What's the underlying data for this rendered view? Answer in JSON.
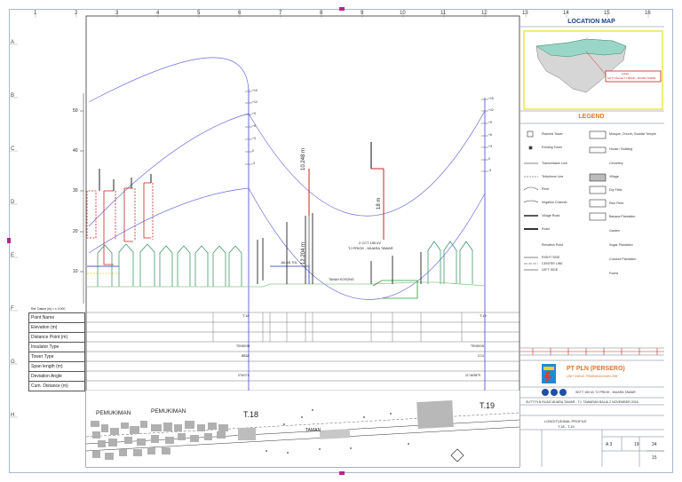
{
  "grid_columns": [
    "1",
    "2",
    "3",
    "4",
    "5",
    "6",
    "7",
    "8",
    "9",
    "10",
    "11",
    "12",
    "13",
    "14",
    "15",
    "16"
  ],
  "grid_rows": [
    "A",
    "B",
    "C",
    "D",
    "E",
    "F",
    "G",
    "H"
  ],
  "location_map": {
    "title": "LOCATION MAP",
    "callout_line1": "Lokasi",
    "callout_line2": "Sel TT Daerah TJ PRIOK - MUARA TAWAR"
  },
  "legend": {
    "title": "LEGEND",
    "left_items": [
      "Planned Tower",
      "Existing Tower",
      "Transmission Line",
      "Telephone Line",
      "River",
      "Irrigation Channel",
      "Village Road",
      "Road",
      "Elevation Point",
      "RIGHT SIDE",
      "CENTER LINE",
      "LEFT SIDE"
    ],
    "right_items": [
      "Mosque, Church, Buddist Temple",
      "House / Building",
      "Cemetery",
      "Village",
      "Dry Field",
      "Rice Field",
      "Banana Plantation",
      "Garden",
      "Sugar Plantation",
      "Coconut Plantation",
      "Forest"
    ]
  },
  "profile": {
    "y_ticks": [
      "50",
      "40",
      "30",
      "20",
      "10"
    ],
    "scale_note": "Ref. Datum (m) = ± 0.000",
    "clearance_vertical": "10.248 m",
    "clearance_lower": "12.204 m",
    "clearance_right": "18 m",
    "sag_label_1": "2 CCT 150 kV",
    "sag_label_2": "TJ PRIOK - MUARA TAWAR",
    "annotation_mid": "JALAN TOL",
    "annotation_right": "TANAH KOSONG",
    "tower_left_scale": [
      "+10",
      "+12",
      "+9",
      "+6",
      "+3",
      "0",
      "-3"
    ],
    "tower_right_scale": [
      "+15",
      "+12",
      "+9",
      "+6",
      "+3",
      "0",
      "-3"
    ]
  },
  "table": {
    "rows": [
      "Point Name",
      "Elevation (m)",
      "Distance  Point (m)",
      "Insulator Type",
      "Tower Type",
      "Span length (m)",
      "Deviation Angle",
      "Cum. Distance (m)"
    ],
    "left_tower": "T.18",
    "right_tower": "T.19",
    "left_insulator": "TENSION",
    "right_insulator": "TENSION",
    "left_type": "BB3A",
    "right_type": "CC4",
    "deviation_left": "0°00'0\"L",
    "deviation_right": "21°46'58\"R"
  },
  "plan": {
    "label_1": "PEMUKIMAN",
    "label_2": "PEMUKIMAN",
    "label_3": "TAMAN",
    "tower_left": "T.18",
    "tower_right": "T.19"
  },
  "title_block": {
    "company": "PT PLN (PERSERO)",
    "company_sub": "UNIT INDUK PEMBANGUNAN JBB",
    "project_line": "SKTT 150 kV TJ PRIOK - MUARA TAWAR",
    "job_line": "SUTT PLN RUAS MUARA TAWAR - TJ. TAWARAN BALAI 2 NOVEMBER 2018",
    "drawing_title": "LONGITUDINAL PROFILE",
    "drawing_sub": "T.18 - T.19",
    "scale": "A 3",
    "sheet_1": "19",
    "sheet_2": "34",
    "sheet_3": "15",
    "accent": "#e0752a",
    "blue": "#1f4fa8"
  },
  "colors": {
    "sag": "#6a6ae0",
    "tower": "#2a2a8a",
    "clearance": "#cc2222",
    "ground": "#2a9a3a",
    "frame": "#a8b8c8"
  }
}
